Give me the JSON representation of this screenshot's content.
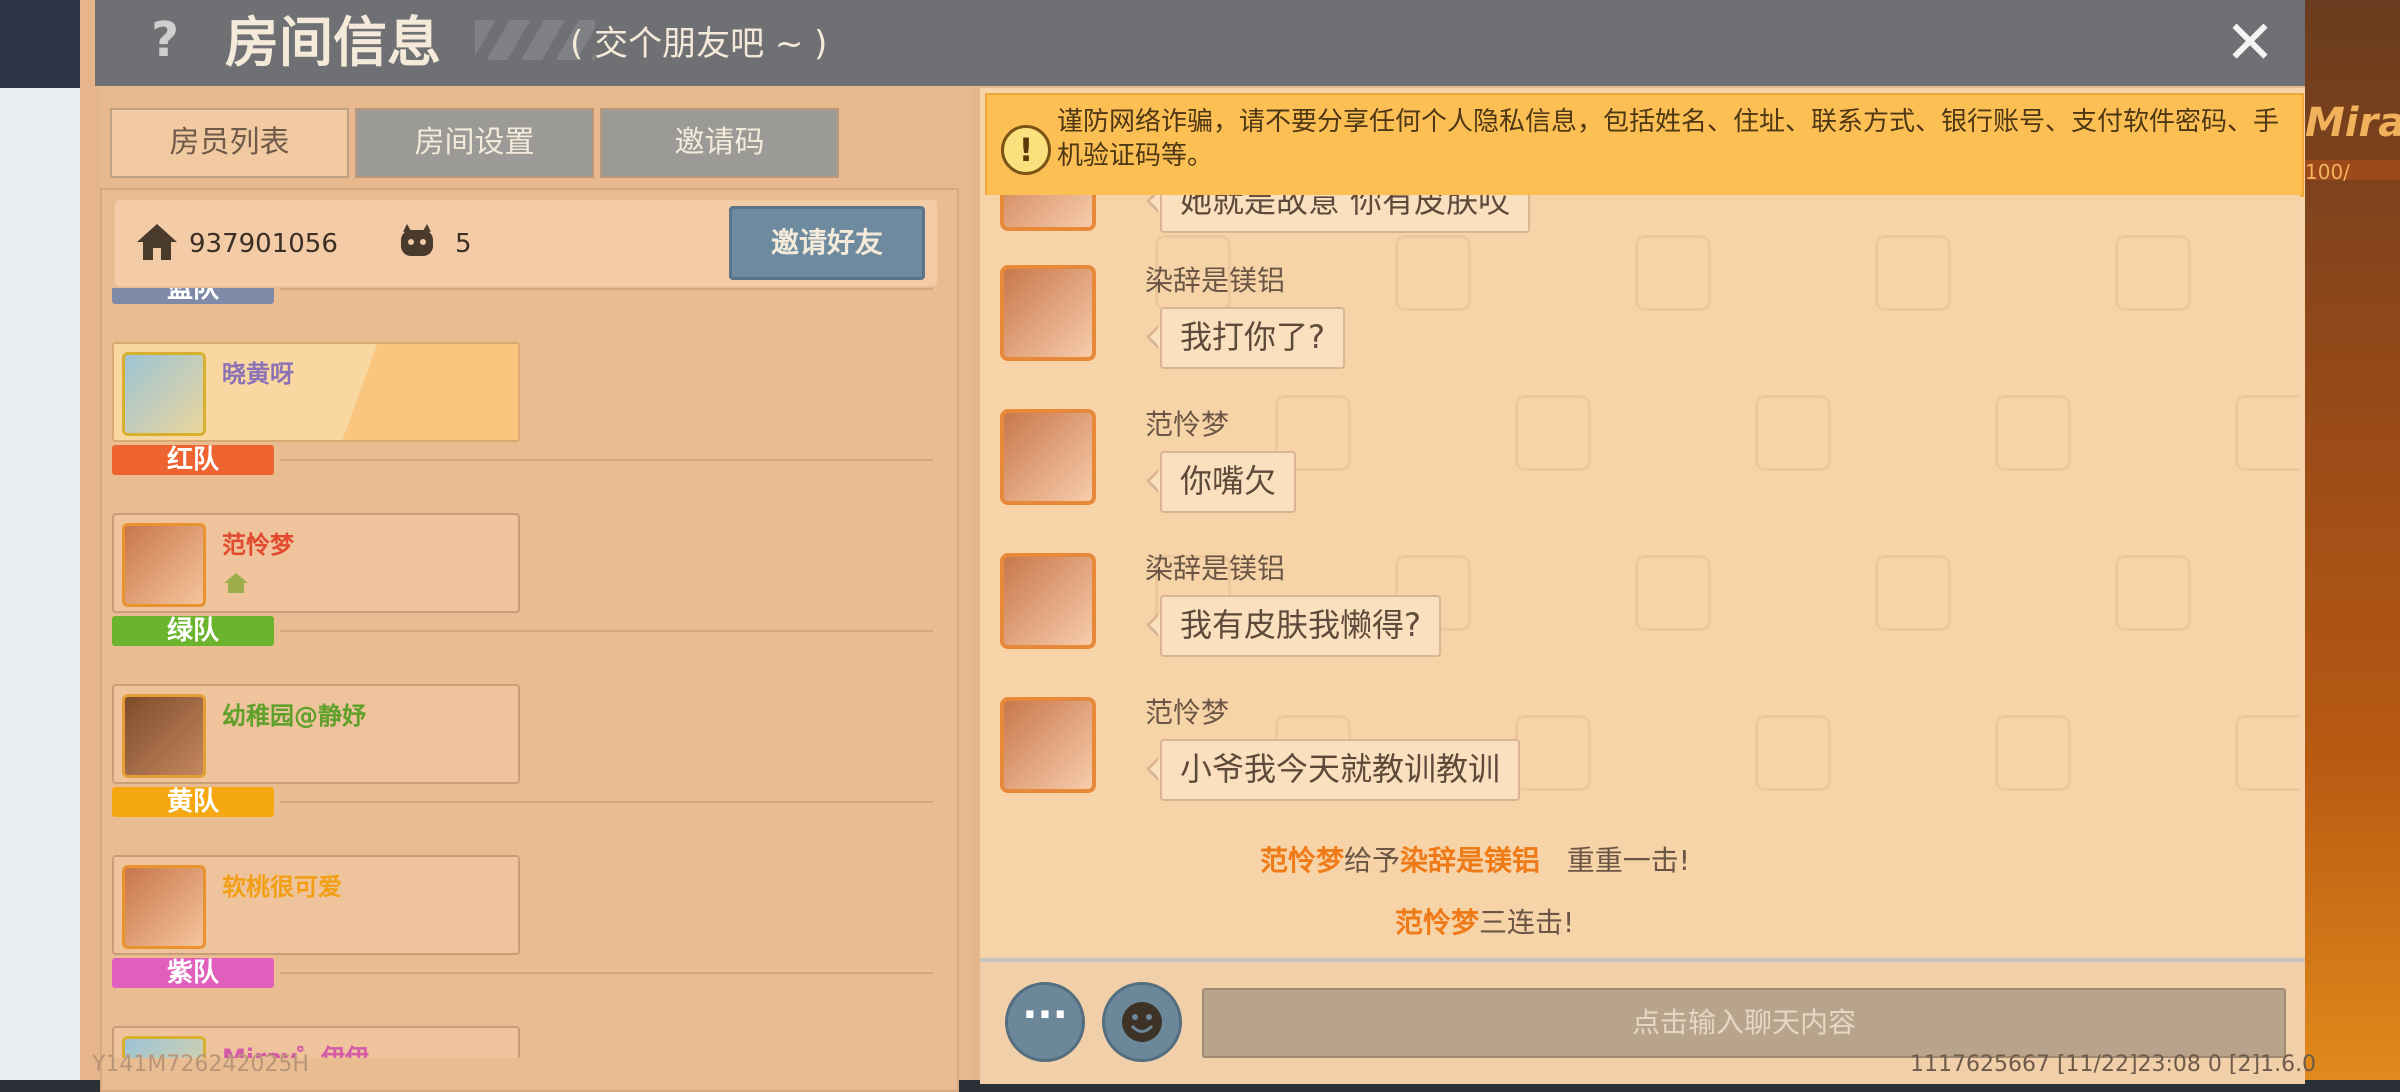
{
  "window": {
    "title": "房间信息",
    "subtitle": "( 交个朋友吧 ~ )",
    "help_symbol": "?",
    "close_symbol": "✕"
  },
  "tabs": [
    {
      "label": "房员列表",
      "active": true
    },
    {
      "label": "房间设置",
      "active": false
    },
    {
      "label": "邀请码",
      "active": false
    }
  ],
  "room": {
    "id": "937901056",
    "player_count": "5",
    "invite_button": "邀请好友"
  },
  "teams": [
    {
      "label": "蓝队",
      "color": "#7f8aa8",
      "players": [
        {
          "name": "晓黄呀",
          "name_color": "#8b72b5",
          "is_me": true
        }
      ]
    },
    {
      "label": "红队",
      "color": "#ee6430",
      "players": [
        {
          "name": "范怜梦",
          "name_color": "#e24a2f",
          "is_host": true
        }
      ]
    },
    {
      "label": "绿队",
      "color": "#6bb42d",
      "players": [
        {
          "name": "幼稚园@静妤",
          "name_color": "#5ea02a"
        }
      ]
    },
    {
      "label": "黄队",
      "color": "#f6a813",
      "players": [
        {
          "name": "软桃很可爱",
          "name_color": "#f29f16"
        }
      ]
    },
    {
      "label": "紫队",
      "color": "#e05fbc",
      "players": [
        {
          "name": "Miray゜伊伊",
          "name_color": "#d55aa8"
        }
      ]
    }
  ],
  "warning": {
    "icon": "!",
    "text": "谨防网络诈骗，请不要分享任何个人隐私信息，包括姓名、住址、联系方式、银行账号、支付软件密码、手机验证码等。"
  },
  "messages": [
    {
      "sender": "",
      "text": "她就是故意 你有皮肤哎",
      "partial": true
    },
    {
      "sender": "染辞是镁铝",
      "text": "我打你了?"
    },
    {
      "sender": "范怜梦",
      "text": "你嘴欠"
    },
    {
      "sender": "染辞是镁铝",
      "text": "我有皮肤我懒得?"
    },
    {
      "sender": "范怜梦",
      "text": "小爷我今天就教训教训"
    }
  ],
  "system_messages": [
    {
      "actor": "范怜梦",
      "verb": "给予",
      "target": "染辞是镁铝",
      "rest": "重重一击!"
    },
    {
      "actor": "范怜梦",
      "verb": "",
      "target": "",
      "rest": "三连击!"
    }
  ],
  "input": {
    "placeholder": "点击输入聊天内容",
    "more_symbol": "···"
  },
  "footer": {
    "left": "Y141M726242025H",
    "right": "1117625667   [11/22]23:08 0   [2]1.6.0"
  },
  "background": {
    "right_label": "Miray",
    "right_sub": "100/"
  }
}
